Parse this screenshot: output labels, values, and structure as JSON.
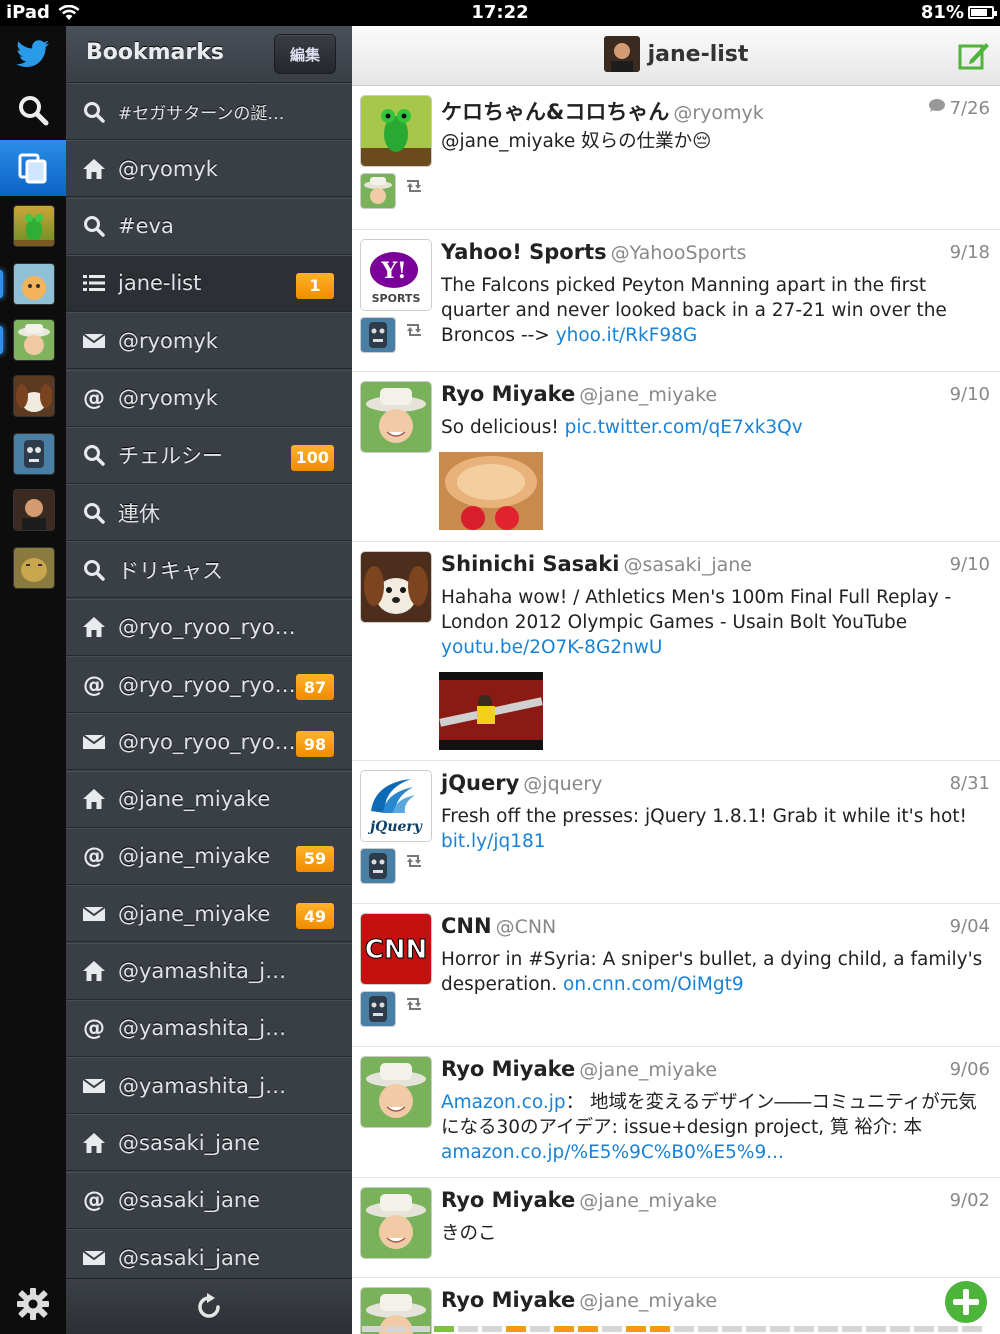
{
  "status_bar": {
    "device": "iPad",
    "time": "17:22",
    "battery": "81%",
    "battery_level": 0.81
  },
  "bookmarks": {
    "title": "Bookmarks",
    "edit_label": "編集",
    "items": [
      {
        "icon": "search-icon",
        "label": "#セガサターンの誕生...",
        "badge": ""
      },
      {
        "icon": "home-icon",
        "label": "@ryomyk",
        "badge": ""
      },
      {
        "icon": "search-icon",
        "label": "#eva",
        "badge": ""
      },
      {
        "icon": "list-icon",
        "label": "jane-list",
        "badge": "1"
      },
      {
        "icon": "mail-icon",
        "label": "@ryomyk",
        "badge": ""
      },
      {
        "icon": "at-icon",
        "label": "@ryomyk",
        "badge": ""
      },
      {
        "icon": "search-icon",
        "label": "チェルシー",
        "badge": "100"
      },
      {
        "icon": "search-icon",
        "label": "連休",
        "badge": ""
      },
      {
        "icon": "search-icon",
        "label": "ドリキャス",
        "badge": ""
      },
      {
        "icon": "home-icon",
        "label": "@ryo_ryoo_ryooo",
        "badge": ""
      },
      {
        "icon": "at-icon",
        "label": "@ryo_ryoo_ryooo",
        "badge": "87"
      },
      {
        "icon": "mail-icon",
        "label": "@ryo_ryoo_ryooo",
        "badge": "98"
      },
      {
        "icon": "home-icon",
        "label": "@jane_miyake",
        "badge": ""
      },
      {
        "icon": "at-icon",
        "label": "@jane_miyake",
        "badge": "59"
      },
      {
        "icon": "mail-icon",
        "label": "@jane_miyake",
        "badge": "49"
      },
      {
        "icon": "home-icon",
        "label": "@yamashita_jane",
        "badge": ""
      },
      {
        "icon": "at-icon",
        "label": "@yamashita_jane",
        "badge": ""
      },
      {
        "icon": "mail-icon",
        "label": "@yamashita_jane",
        "badge": ""
      },
      {
        "icon": "home-icon",
        "label": "@sasaki_jane",
        "badge": ""
      },
      {
        "icon": "at-icon",
        "label": "@sasaki_jane",
        "badge": ""
      },
      {
        "icon": "mail-icon",
        "label": "@sasaki_jane",
        "badge": ""
      }
    ],
    "footer_icon": "refresh-icon"
  },
  "timeline": {
    "title": "jane-list",
    "tweets": [
      {
        "name": "ケロちゃん&コロちゃん",
        "handle": "@ryomyk",
        "date": "7/26",
        "reply": true,
        "text": "@jane_miyake 奴らの仕業か😔",
        "link": ""
      },
      {
        "name": "Yahoo! Sports",
        "handle": "@YahooSports",
        "date": "9/18",
        "reply": false,
        "text": "The Falcons picked Peyton Manning apart in the first quarter and never looked back in a 27-21 win over the Broncos -->",
        "link": "yhoo.it/RkF98G"
      },
      {
        "name": "Ryo Miyake",
        "handle": "@jane_miyake",
        "date": "9/10",
        "reply": false,
        "text": "So delicious!",
        "link": "pic.twitter.com/qE7xk3Qv"
      },
      {
        "name": "Shinichi Sasaki",
        "handle": "@sasaki_jane",
        "date": "9/10",
        "reply": false,
        "text": "Hahaha wow! / Athletics Men's 100m Final Full Replay - London 2012 Olympic Games - Usain Bolt YouTube",
        "link": "youtu.be/2O7K-8G2nwU"
      },
      {
        "name": "jQuery",
        "handle": "@jquery",
        "date": "8/31",
        "reply": false,
        "text": "Fresh off the presses: jQuery 1.8.1! Grab it while it's hot!",
        "link": "bit.ly/jq181"
      },
      {
        "name": "CNN",
        "handle": "@CNN",
        "date": "9/04",
        "reply": false,
        "text": "Horror in #Syria: A sniper's bullet, a dying child, a family's desperation.",
        "link": "on.cnn.com/OiMgt9"
      },
      {
        "name": "Ryo Miyake",
        "handle": "@jane_miyake",
        "date": "9/06",
        "reply": false,
        "link_pre": "Amazon.co.jp",
        "text": "： 地域を変えるデザイン――コミュニティが元気になる30のアイデア: issue+design project, 筧 裕介: 本",
        "link": "amazon.co.jp/%E5%9C%B0%E5%9..."
      },
      {
        "name": "Ryo Miyake",
        "handle": "@jane_miyake",
        "date": "9/02",
        "reply": false,
        "text": "きのこ",
        "link": ""
      },
      {
        "name": "Ryo Miyake",
        "handle": "@jane_miyake",
        "date": "",
        "reply": false,
        "text": "",
        "link": ""
      }
    ]
  },
  "colors": {
    "accent": "#1a82d6",
    "badge": "#f39a10",
    "rail_selected": "#1577d8"
  }
}
